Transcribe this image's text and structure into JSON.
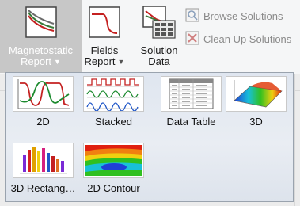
{
  "ribbon": {
    "magnetostatic_label_1": "Magnetostatic",
    "magnetostatic_label_2": "Report",
    "fields_label_1": "Fields",
    "fields_label_2": "Report",
    "solution_label_1": "Solution",
    "solution_label_2": "Data",
    "browse_solutions": "Browse Solutions",
    "clean_up_solutions": "Clean Up Solutions"
  },
  "menu": {
    "items": [
      {
        "label": "2D",
        "icon": "2d-plot-icon"
      },
      {
        "label": "Stacked",
        "icon": "stacked-plot-icon"
      },
      {
        "label": "Data Table",
        "icon": "data-table-icon"
      },
      {
        "label": "3D",
        "icon": "3d-plot-icon"
      },
      {
        "label": "3D Rectang…",
        "icon": "3d-rectangular-plot-icon"
      },
      {
        "label": "2D Contour",
        "icon": "2d-contour-plot-icon"
      }
    ]
  },
  "colors": {
    "accent_red": "#d62020",
    "accent_green": "#1c8a2e",
    "accent_blue": "#1f56c8"
  }
}
